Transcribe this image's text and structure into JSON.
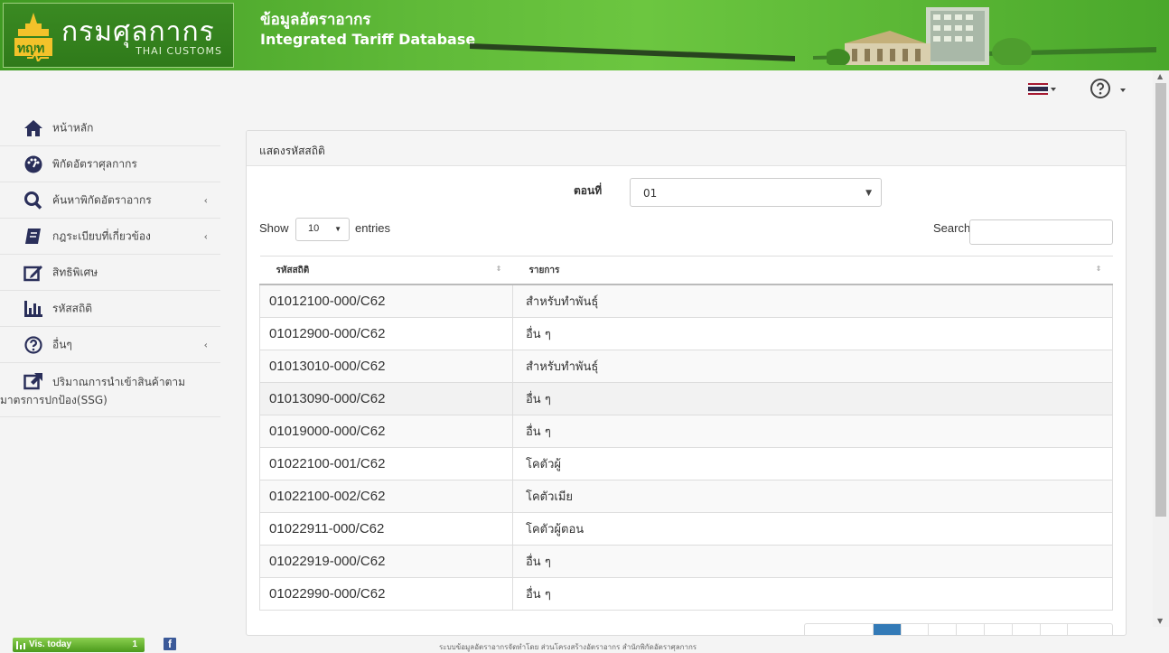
{
  "header": {
    "logo_text": "กรมศุลกากร",
    "logo_sub": "THAI CUSTOMS",
    "title_th": "ข้อมูลอัตราอากร",
    "title_en": "Integrated Tariff Database"
  },
  "topbar": {
    "language_icon": "thai-flag-icon",
    "help_icon": "question-circle-icon"
  },
  "sidebar": {
    "items": [
      {
        "label": "หน้าหลัก",
        "icon": "home-icon"
      },
      {
        "label": "พิกัดอัตราศุลกากร",
        "icon": "dashboard-icon"
      },
      {
        "label": "ค้นหาพิกัดอัตราอากร",
        "icon": "search-icon"
      },
      {
        "label": "กฎระเบียบที่เกี่ยวข้อง",
        "icon": "book-icon"
      },
      {
        "label": "สิทธิพิเศษ",
        "icon": "edit-icon"
      },
      {
        "label": "รหัสสถิติ",
        "icon": "bar-chart-icon"
      },
      {
        "label": "อื่นๆ",
        "icon": "question-circle-icon"
      },
      {
        "label_line1": "ปริมาณการนำเข้าสินค้าตาม",
        "label_line2": "มาตรการปกป้อง(SSG)",
        "icon": "external-link-icon"
      }
    ]
  },
  "panel": {
    "title": "แสดงรหัสสถิติ",
    "chapter_label": "ตอนที่",
    "chapter_value": "01",
    "show_label": "Show",
    "show_value": "10",
    "entries_label": "entries",
    "search_label": "Search:",
    "search_value": ""
  },
  "table": {
    "headers": [
      "รหัสสถิติ",
      "รายการ"
    ],
    "rows": [
      [
        "01012100-000/C62",
        "สำหรับทำพันธุ์"
      ],
      [
        "01012900-000/C62",
        "อื่น ๆ"
      ],
      [
        "01013010-000/C62",
        "สำหรับทำพันธุ์"
      ],
      [
        "01013090-000/C62",
        "อื่น ๆ"
      ],
      [
        "01019000-000/C62",
        "อื่น ๆ"
      ],
      [
        "01022100-001/C62",
        "โคตัวผู้"
      ],
      [
        "01022100-002/C62",
        "โคตัวเมีย"
      ],
      [
        "01022911-000/C62",
        "โคตัวผู้ตอน"
      ],
      [
        "01022919-000/C62",
        "อื่น ๆ"
      ],
      [
        "01022990-000/C62",
        "อื่น ๆ"
      ]
    ]
  },
  "footer": {
    "visits_label": "Vis. today",
    "visits_count": "1",
    "facebook_icon": "facebook-icon",
    "text": "ระบบข้อมูลอัตราอากรจัดทำโดย ส่วนโครงสร้างอัตราอากร สำนักพิกัดอัตราศุลกากร"
  },
  "colors": {
    "header_green": "#5fb938",
    "pager_active": "#337ab7"
  }
}
